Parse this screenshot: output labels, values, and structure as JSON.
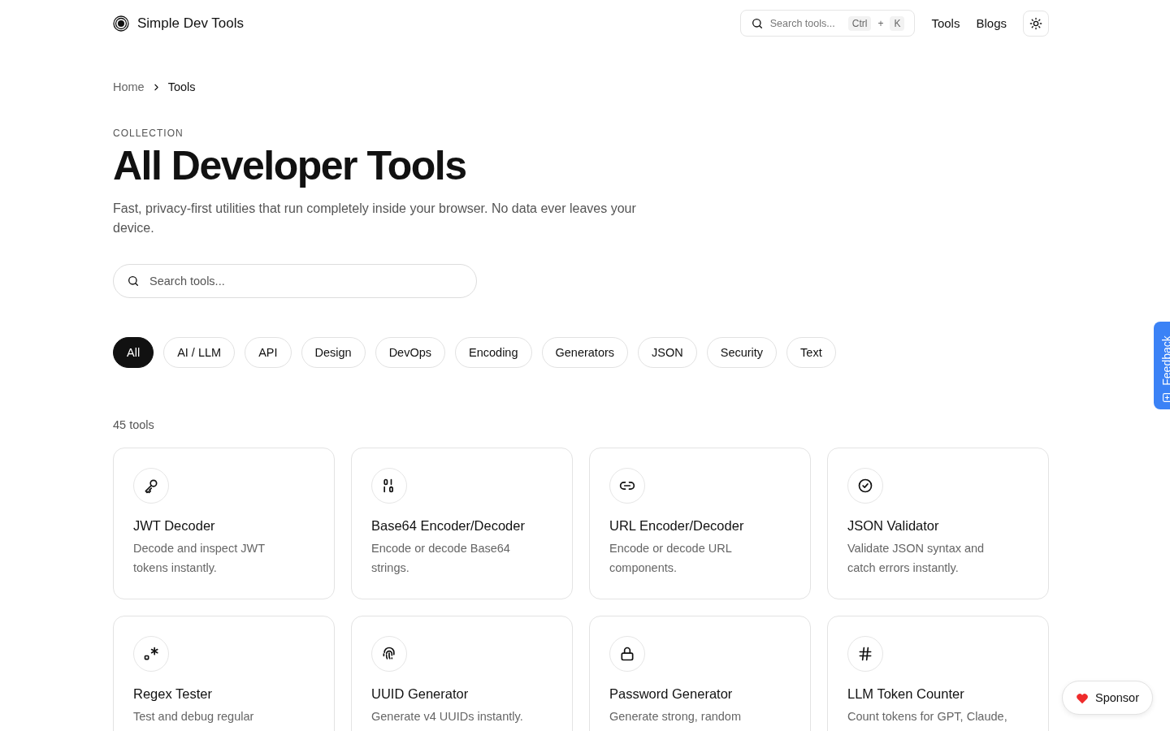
{
  "header": {
    "brand": "Simple Dev Tools",
    "search": {
      "placeholder": "Search tools...",
      "shortcut": [
        "Ctrl",
        "+",
        "K"
      ]
    },
    "nav": [
      "Tools",
      "Blogs"
    ]
  },
  "breadcrumb": [
    "Home",
    "Tools"
  ],
  "eyebrow": "COLLECTION",
  "title": "All Developer Tools",
  "subtitle": "Fast, privacy-first utilities that run completely inside your browser. No data ever leaves your device.",
  "search": {
    "placeholder": "Search tools..."
  },
  "filters": [
    {
      "label": "All",
      "selected": true
    },
    {
      "label": "AI / LLM",
      "selected": false
    },
    {
      "label": "API",
      "selected": false
    },
    {
      "label": "Design",
      "selected": false
    },
    {
      "label": "DevOps",
      "selected": false
    },
    {
      "label": "Encoding",
      "selected": false
    },
    {
      "label": "Generators",
      "selected": false
    },
    {
      "label": "JSON",
      "selected": false
    },
    {
      "label": "Security",
      "selected": false
    },
    {
      "label": "Text",
      "selected": false
    }
  ],
  "count": "45 tools",
  "tools": [
    {
      "kind": "key",
      "name": "JWT Decoder",
      "description": "Decode and inspect JWT tokens instantly."
    },
    {
      "kind": "binary",
      "name": "Base64 Encoder/Decoder",
      "description": "Encode or decode Base64 strings."
    },
    {
      "kind": "link",
      "name": "URL Encoder/Decoder",
      "description": "Encode or decode URL components."
    },
    {
      "kind": "check",
      "name": "JSON Validator",
      "description": "Validate JSON syntax and catch errors instantly."
    },
    {
      "kind": "regex",
      "name": "Regex Tester",
      "description": "Test and debug regular"
    },
    {
      "kind": "fingerprint",
      "name": "UUID Generator",
      "description": "Generate v4 UUIDs instantly."
    },
    {
      "kind": "lock",
      "name": "Password Generator",
      "description": "Generate strong, random"
    },
    {
      "kind": "hash",
      "name": "LLM Token Counter",
      "description": "Count tokens for GPT, Claude,"
    }
  ],
  "feedback": "Feedback",
  "sponsor": "Sponsor"
}
